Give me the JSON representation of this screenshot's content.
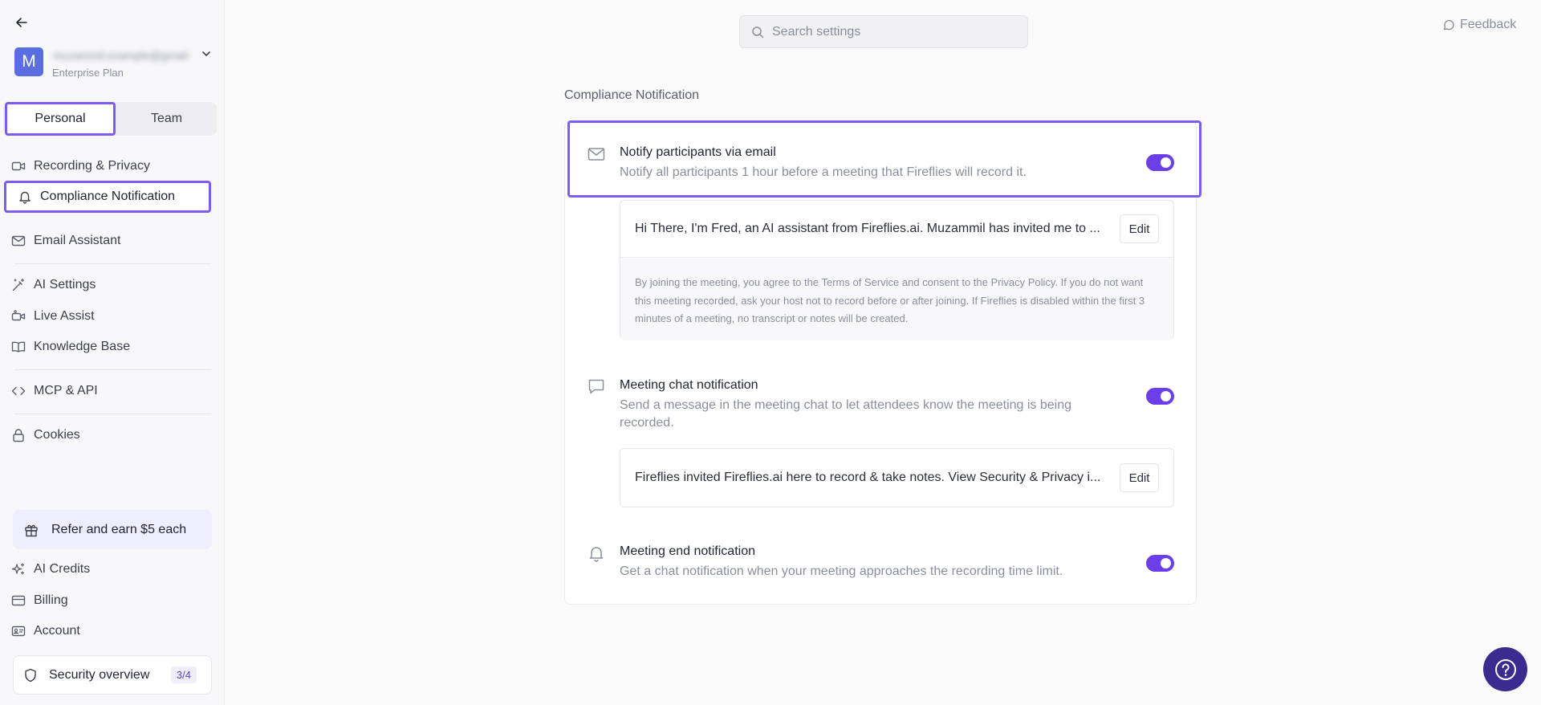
{
  "sidebar": {
    "account": {
      "avatar_letter": "M",
      "email": "muzammil.example@gmail.com",
      "plan": "Enterprise Plan"
    },
    "tabs": {
      "personal": "Personal",
      "team": "Team"
    },
    "items": [
      {
        "label": "Recording & Privacy",
        "icon": "video-icon"
      },
      {
        "label": "Compliance Notification",
        "icon": "bell-icon"
      },
      {
        "label": "Email Assistant",
        "icon": "mail-icon"
      },
      {
        "label": "AI Settings",
        "icon": "wand-icon"
      },
      {
        "label": "Live Assist",
        "icon": "video-assist-icon"
      },
      {
        "label": "Knowledge Base",
        "icon": "book-icon"
      },
      {
        "label": "MCP & API",
        "icon": "code-icon"
      },
      {
        "label": "Cookies",
        "icon": "lock-icon"
      }
    ],
    "refer": "Refer and earn $5 each",
    "bottom_items": [
      {
        "label": "AI Credits",
        "icon": "sparkle-icon"
      },
      {
        "label": "Billing",
        "icon": "card-icon"
      },
      {
        "label": "Account",
        "icon": "id-card-icon"
      }
    ],
    "security": {
      "label": "Security overview",
      "badge": "3/4"
    }
  },
  "header": {
    "search_placeholder": "Search settings",
    "feedback": "Feedback"
  },
  "main": {
    "section_title": "Compliance Notification",
    "email": {
      "title": "Notify participants via email",
      "desc": "Notify all participants 1 hour before a meeting that Fireflies will record it.",
      "enabled": true,
      "message": "Hi There, I'm Fred, an AI assistant from Fireflies.ai. Muzammil has invited me to ...",
      "edit": "Edit",
      "footer": "By joining the meeting, you agree to the Terms of Service and consent to the Privacy Policy. If you do not want this meeting recorded, ask your host not to record before or after joining. If Fireflies is disabled within the first 3 minutes of a meeting, no transcript or notes will be created."
    },
    "chat": {
      "title": "Meeting chat notification",
      "desc": "Send a message in the meeting chat to let attendees know the meeting is being recorded.",
      "enabled": true,
      "message": "Fireflies invited Fireflies.ai here to record & take notes. View Security & Privacy i...",
      "edit": "Edit"
    },
    "end": {
      "title": "Meeting end notification",
      "desc": "Get a chat notification when your meeting approaches the recording time limit.",
      "enabled": true
    }
  },
  "colors": {
    "accent": "#6b3fe8",
    "highlight": "#7d5cf4",
    "help": "#3b2a8f"
  }
}
